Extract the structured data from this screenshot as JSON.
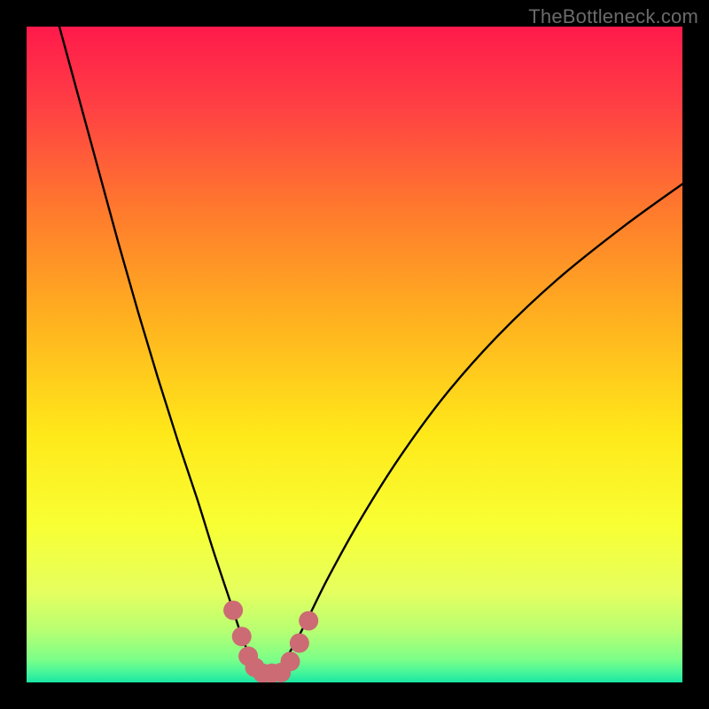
{
  "watermark": "TheBottleneck.com",
  "colors": {
    "frame": "#000000",
    "curve": "#000000",
    "marker": "#cc6b73",
    "gradient_stops": [
      {
        "offset": 0.0,
        "color": "#ff1a4b"
      },
      {
        "offset": 0.12,
        "color": "#ff3f44"
      },
      {
        "offset": 0.28,
        "color": "#ff7a2d"
      },
      {
        "offset": 0.45,
        "color": "#ffb21f"
      },
      {
        "offset": 0.62,
        "color": "#ffe81a"
      },
      {
        "offset": 0.76,
        "color": "#f8ff33"
      },
      {
        "offset": 0.86,
        "color": "#e6ff5e"
      },
      {
        "offset": 0.92,
        "color": "#b9ff72"
      },
      {
        "offset": 0.965,
        "color": "#7cff88"
      },
      {
        "offset": 0.985,
        "color": "#45f59a"
      },
      {
        "offset": 1.0,
        "color": "#19e6a3"
      }
    ]
  },
  "chart_data": {
    "type": "line",
    "title": "",
    "xlabel": "",
    "ylabel": "",
    "xlim": [
      0,
      100
    ],
    "ylim": [
      0,
      100
    ],
    "grid": false,
    "legend": false,
    "series": [
      {
        "name": "bottleneck-curve",
        "x": [
          5,
          8,
          11,
          14,
          17,
          20,
          23,
          26,
          28.5,
          31,
          33,
          34.8,
          36,
          37,
          39,
          42,
          46,
          51,
          57,
          64,
          72,
          81,
          91,
          100
        ],
        "y": [
          100,
          89,
          78,
          67,
          56.5,
          46.5,
          37,
          28,
          20,
          12.5,
          6.5,
          2.5,
          0.8,
          0.8,
          2.8,
          8,
          16,
          25,
          34.5,
          44,
          53,
          61.5,
          69.5,
          76
        ]
      }
    ],
    "markers": {
      "name": "highlight-near-minimum",
      "points": [
        {
          "x": 31.5,
          "y": 11
        },
        {
          "x": 32.8,
          "y": 7
        },
        {
          "x": 33.8,
          "y": 4
        },
        {
          "x": 34.8,
          "y": 2.3
        },
        {
          "x": 36.0,
          "y": 1.4
        },
        {
          "x": 37.4,
          "y": 1.4
        },
        {
          "x": 38.8,
          "y": 1.5
        },
        {
          "x": 40.2,
          "y": 3.2
        },
        {
          "x": 41.6,
          "y": 6.0
        },
        {
          "x": 43.0,
          "y": 9.4
        }
      ],
      "radius_px": 11
    }
  }
}
